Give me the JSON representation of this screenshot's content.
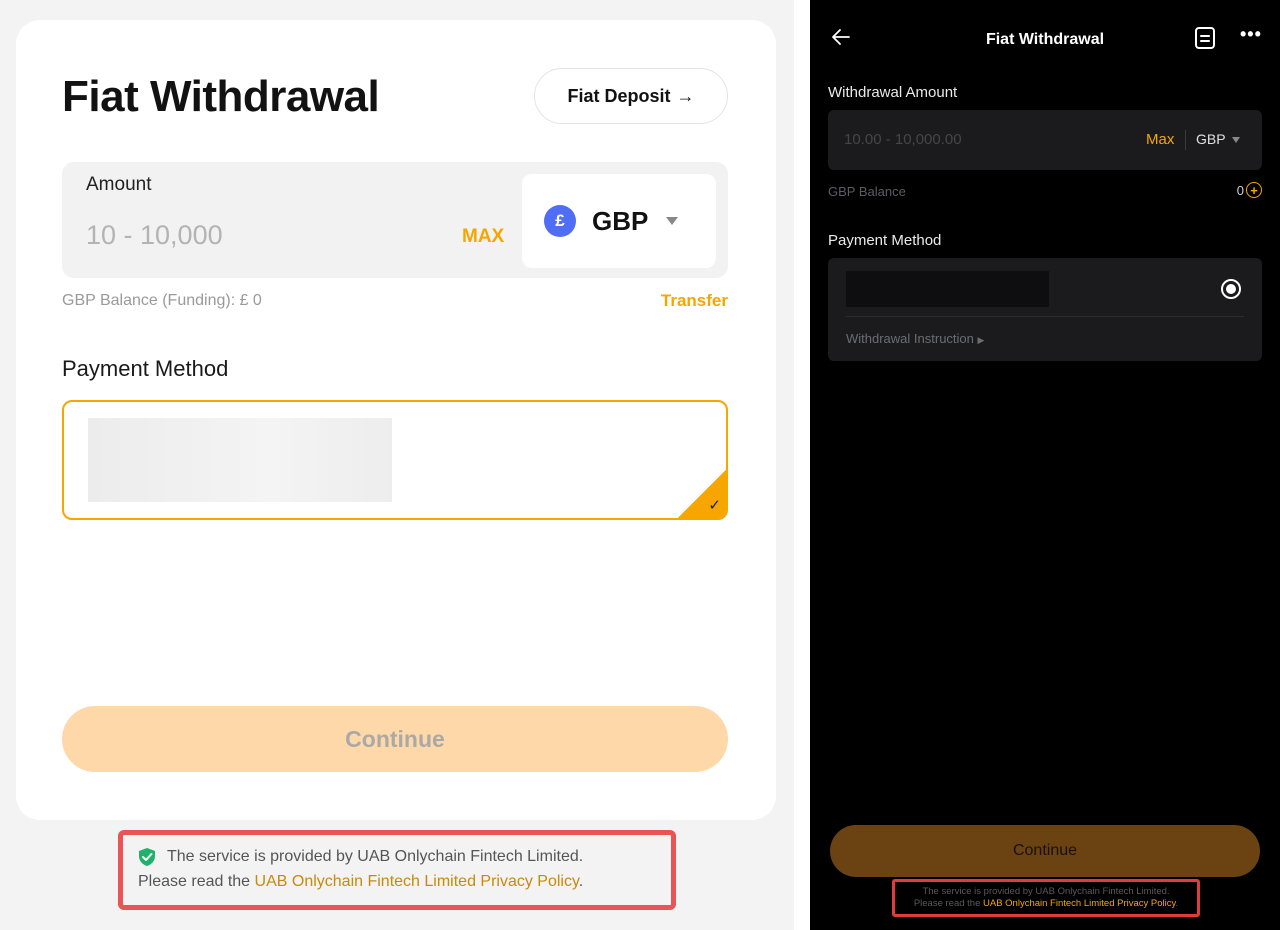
{
  "web": {
    "title": "Fiat Withdrawal",
    "deposit_button": "Fiat Deposit",
    "amount": {
      "label": "Amount",
      "placeholder": "10 - 10,000",
      "max_label": "MAX",
      "currency_symbol": "£",
      "currency": "GBP"
    },
    "balance_text": "GBP Balance (Funding): £ 0",
    "transfer_label": "Transfer",
    "payment_method_title": "Payment Method",
    "continue_label": "Continue",
    "footer": {
      "line1": "The service is provided by UAB Onlychain Fintech Limited.",
      "line2_prefix": "Please read the ",
      "line2_link": "UAB Onlychain Fintech Limited Privacy Policy",
      "line2_suffix": "."
    },
    "colors": {
      "accent": "#f7a600",
      "highlight_border": "#ea5455",
      "currency_icon": "#4f6df5"
    }
  },
  "mobile": {
    "title": "Fiat Withdrawal",
    "withdrawal_amount_label": "Withdrawal Amount",
    "amount_placeholder": "10.00 - 10,000.00",
    "max_label": "Max",
    "currency": "GBP",
    "balance_label": "GBP Balance",
    "balance_value": "0",
    "payment_method_title": "Payment Method",
    "instruction_label": "Withdrawal Instruction",
    "continue_label": "Continue",
    "footer": {
      "line1": "The service is provided by UAB Onlychain Fintech Limited.",
      "line2_prefix": "Please read the ",
      "line2_link": "UAB Onlychain Fintech Limited Privacy Policy",
      "line2_suffix": "."
    },
    "icons": [
      "back-arrow-icon",
      "document-icon",
      "more-icon",
      "add-circle-icon",
      "radio-selected-icon",
      "caret-right-icon"
    ]
  }
}
